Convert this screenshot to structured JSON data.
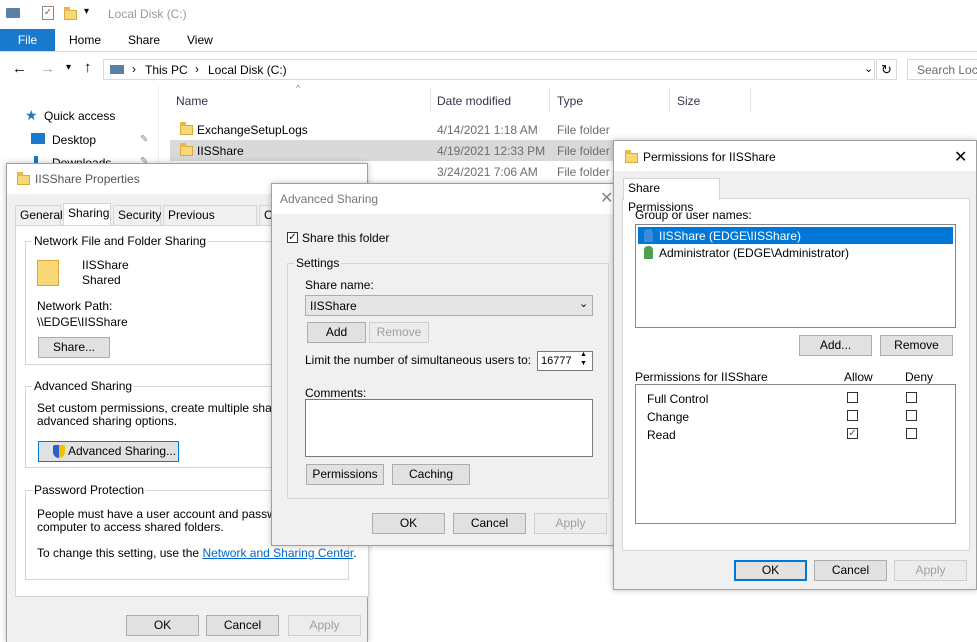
{
  "explorer": {
    "title": "Local Disk (C:)",
    "ribbon_tabs": [
      "File",
      "Home",
      "Share",
      "View"
    ],
    "path": [
      "This PC",
      "Local Disk (C:)"
    ],
    "search_placeholder": "Search Loca",
    "nav": {
      "quick_access": "Quick access",
      "desktop": "Desktop",
      "downloads": "Downloads"
    },
    "columns": {
      "name": "Name",
      "date": "Date modified",
      "type": "Type",
      "size": "Size"
    },
    "rows": [
      {
        "name": "ExchangeSetupLogs",
        "date": "4/14/2021 1:18 AM",
        "type": "File folder"
      },
      {
        "name": "IISShare",
        "date": "4/19/2021 12:33 PM",
        "type": "File folder"
      },
      {
        "name": "",
        "date": "3/24/2021 7:06 AM",
        "type": "File folder"
      }
    ]
  },
  "props": {
    "title": "IISShare Properties",
    "tabs": [
      "General",
      "Sharing",
      "Security",
      "Previous Versions",
      "Cu"
    ],
    "nffs_label": "Network File and Folder Sharing",
    "folder_name": "IISShare",
    "shared_status": "Shared",
    "net_path_label": "Network Path:",
    "net_path": "\\\\EDGE\\IISShare",
    "share_btn": "Share...",
    "adv_label": "Advanced Sharing",
    "adv_desc1": "Set custom permissions, create multiple shares, an",
    "adv_desc2": "advanced sharing options.",
    "adv_btn": "Advanced Sharing...",
    "pw_label": "Password Protection",
    "pw_desc1": "People must have a user account and password fo",
    "pw_desc2": "computer to access shared folders.",
    "pw_desc3": "To change this setting, use the",
    "pw_link": "Network and Sharing Center",
    "ok": "OK",
    "cancel": "Cancel",
    "apply": "Apply"
  },
  "adv": {
    "title": "Advanced Sharing",
    "share_this_folder": "Share this folder",
    "settings_label": "Settings",
    "share_name_label": "Share name:",
    "share_name": "IISShare",
    "add": "Add",
    "remove": "Remove",
    "limit_label": "Limit the number of simultaneous users to:",
    "limit_value": "16777",
    "comments_label": "Comments:",
    "permissions": "Permissions",
    "caching": "Caching",
    "ok": "OK",
    "cancel": "Cancel",
    "apply": "Apply"
  },
  "perm": {
    "title": "Permissions for IISShare",
    "tab": "Share Permissions",
    "group_label": "Group or user names:",
    "users": [
      "IISShare (EDGE\\IISShare)",
      "Administrator (EDGE\\Administrator)"
    ],
    "add": "Add...",
    "remove": "Remove",
    "perm_header": "Permissions for IISShare",
    "allow": "Allow",
    "deny": "Deny",
    "perms": [
      {
        "name": "Full Control",
        "allow": false,
        "deny": false
      },
      {
        "name": "Change",
        "allow": false,
        "deny": false
      },
      {
        "name": "Read",
        "allow": true,
        "deny": false
      }
    ],
    "ok": "OK",
    "cancel": "Cancel",
    "apply": "Apply"
  }
}
